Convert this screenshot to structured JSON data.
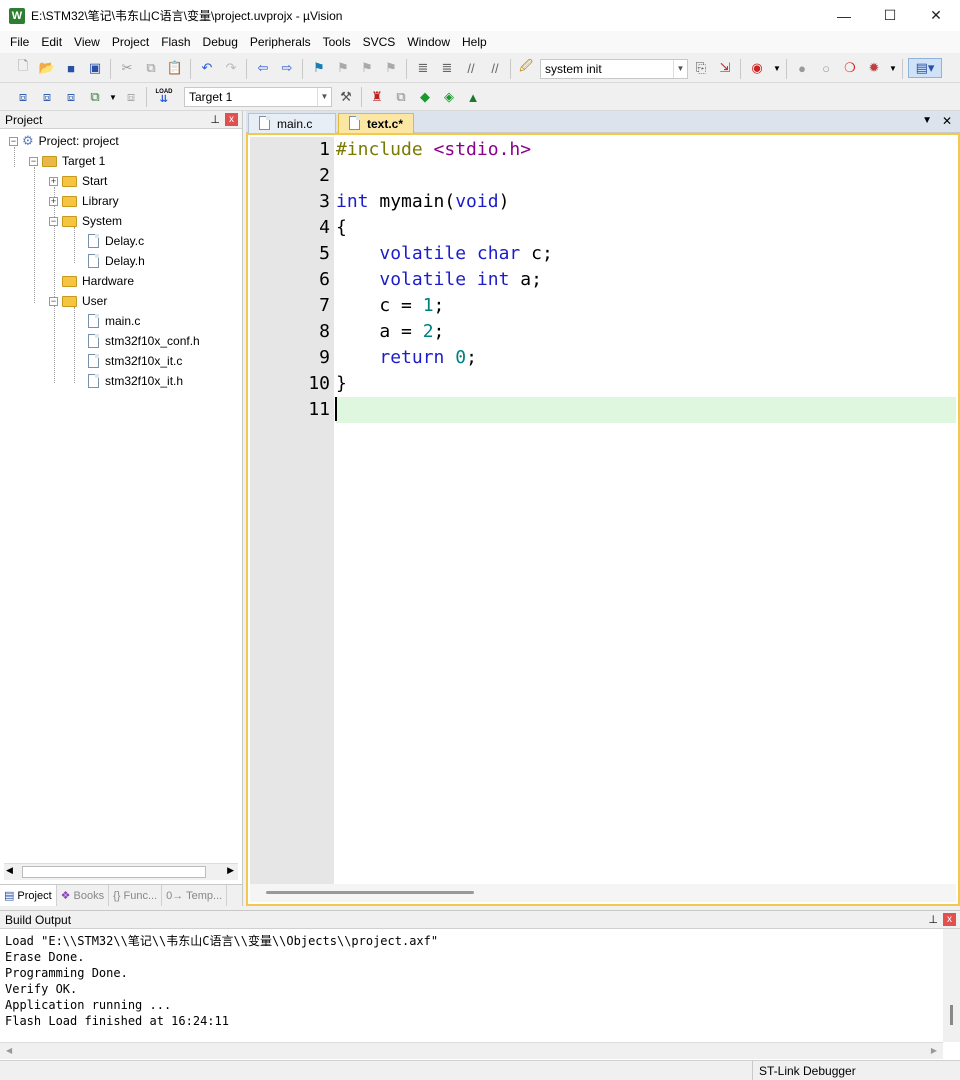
{
  "window": {
    "title": "E:\\STM32\\笔记\\韦东山C语言\\变量\\project.uvprojx - µVision",
    "icon_letter": "W",
    "minimize": "—",
    "maximize": "☐",
    "close": "✕"
  },
  "menu": [
    "File",
    "Edit",
    "View",
    "Project",
    "Flash",
    "Debug",
    "Peripherals",
    "Tools",
    "SVCS",
    "Window",
    "Help"
  ],
  "toolbar1": {
    "find_combo": "system init"
  },
  "toolbar2": {
    "target_combo": "Target 1",
    "load_label": "LOAD"
  },
  "project_panel": {
    "title": "Project",
    "pin": "📌",
    "close": "x",
    "tree": {
      "root": "Project: project",
      "target": "Target 1",
      "groups": [
        "Start",
        "Library",
        "System",
        "Hardware",
        "User"
      ],
      "system_files": [
        "Delay.c",
        "Delay.h"
      ],
      "user_files": [
        "main.c",
        "stm32f10x_conf.h",
        "stm32f10x_it.c",
        "stm32f10x_it.h"
      ]
    },
    "tabs": [
      "Project",
      "Books",
      "{} Func...",
      "0→ Temp..."
    ]
  },
  "editor": {
    "tabs": [
      "main.c",
      "text.c*"
    ],
    "active_tab": 1,
    "dropdown": "▼",
    "close": "✕",
    "line_numbers": [
      "1",
      "2",
      "3",
      "4",
      "5",
      "6",
      "7",
      "8",
      "9",
      "10",
      "11"
    ],
    "current_line": 11
  },
  "build_output": {
    "title": "Build Output",
    "pin": "📌",
    "close": "x",
    "lines": [
      "Load \"E:\\\\STM32\\\\笔记\\\\韦东山C语言\\\\变量\\\\Objects\\\\project.axf\"",
      "Erase Done.",
      "Programming Done.",
      "Verify OK.",
      "Application running ...",
      "Flash Load finished at 16:24:11"
    ]
  },
  "status": {
    "debugger": "ST-Link Debugger"
  }
}
